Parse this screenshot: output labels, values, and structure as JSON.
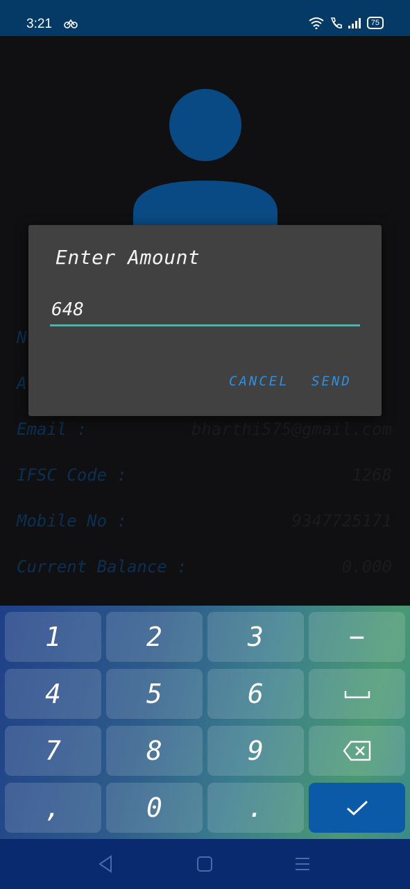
{
  "status_bar": {
    "time": "3:21",
    "battery": "75",
    "icons": [
      "notification-icon",
      "wifi-icon",
      "call-icon",
      "signal-icon",
      "battery-icon"
    ]
  },
  "profile": {
    "rows": [
      {
        "label": "N",
        "value": ""
      },
      {
        "label": "A",
        "value": ""
      },
      {
        "label": "Email :",
        "value": "bharthi575@gmail.com"
      },
      {
        "label": "IFSC Code :",
        "value": "1268"
      },
      {
        "label": "Mobile No :",
        "value": "9347725171"
      },
      {
        "label": "Current Balance :",
        "value": "0.000"
      }
    ]
  },
  "dialog": {
    "title": "Enter Amount",
    "amount_value": "648",
    "cancel_label": "CANCEL",
    "send_label": "SEND"
  },
  "keyboard": {
    "keys": [
      {
        "label": "1",
        "name": "key-1"
      },
      {
        "label": "2",
        "name": "key-2"
      },
      {
        "label": "3",
        "name": "key-3"
      },
      {
        "label": "−",
        "name": "key-minus"
      },
      {
        "label": "4",
        "name": "key-4"
      },
      {
        "label": "5",
        "name": "key-5"
      },
      {
        "label": "6",
        "name": "key-6"
      },
      {
        "label": "",
        "name": "key-space"
      },
      {
        "label": "7",
        "name": "key-7"
      },
      {
        "label": "8",
        "name": "key-8"
      },
      {
        "label": "9",
        "name": "key-9"
      },
      {
        "label": "",
        "name": "key-backspace"
      },
      {
        "label": ",",
        "name": "key-comma"
      },
      {
        "label": "0",
        "name": "key-0"
      },
      {
        "label": ".",
        "name": "key-period"
      },
      {
        "label": "",
        "name": "key-done"
      }
    ],
    "colors": {
      "accent": "#1fc7ba",
      "done_key": "#0a5aa8"
    }
  },
  "nav_bar": {
    "icons": [
      "back-icon",
      "home-icon",
      "menu-icon"
    ]
  }
}
